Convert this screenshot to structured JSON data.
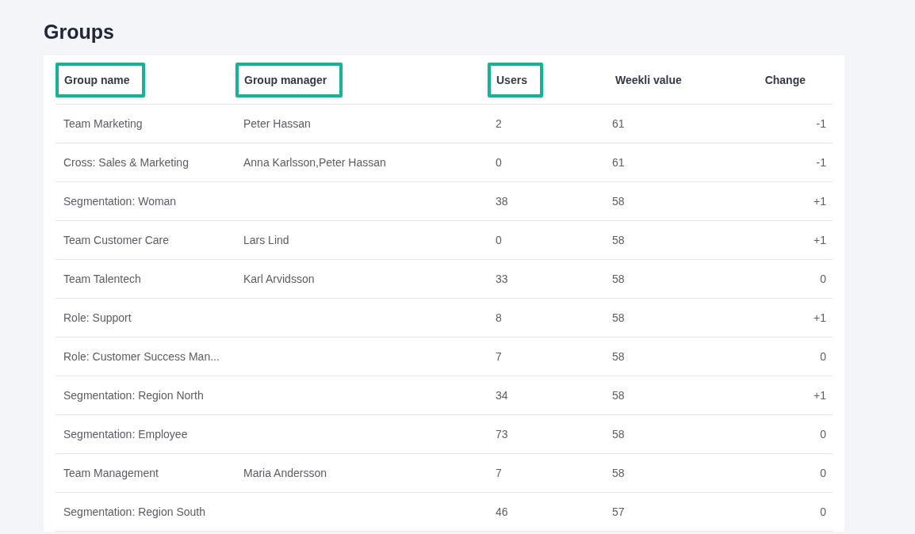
{
  "title": "Groups",
  "table": {
    "columns": [
      {
        "label": "Group name",
        "highlighted": true
      },
      {
        "label": "Group manager",
        "highlighted": true
      },
      {
        "label": "Users",
        "highlighted": true
      },
      {
        "label": "Weekli value",
        "highlighted": false
      },
      {
        "label": "Change",
        "highlighted": false
      }
    ],
    "rows": [
      [
        "Team Marketing",
        "Peter Hassan",
        "2",
        "61",
        "-1"
      ],
      [
        "Cross: Sales & Marketing",
        "Anna Karlsson,Peter Hassan",
        "0",
        "61",
        "-1"
      ],
      [
        "Segmentation: Woman",
        "",
        "38",
        "58",
        "+1"
      ],
      [
        "Team Customer Care",
        "Lars Lind",
        "0",
        "58",
        "+1"
      ],
      [
        "Team Talentech",
        "Karl Arvidsson",
        "33",
        "58",
        "0"
      ],
      [
        "Role: Support",
        "",
        "8",
        "58",
        "+1"
      ],
      [
        "Role: Customer Success Man...",
        "",
        "7",
        "58",
        "0"
      ],
      [
        "Segmentation: Region North",
        "",
        "34",
        "58",
        "+1"
      ],
      [
        "Segmentation: Employee",
        "",
        "73",
        "58",
        "0"
      ],
      [
        "Team Management",
        "Maria Andersson",
        "7",
        "58",
        "0"
      ],
      [
        "Segmentation: Region South",
        "",
        "46",
        "57",
        "0"
      ]
    ]
  }
}
